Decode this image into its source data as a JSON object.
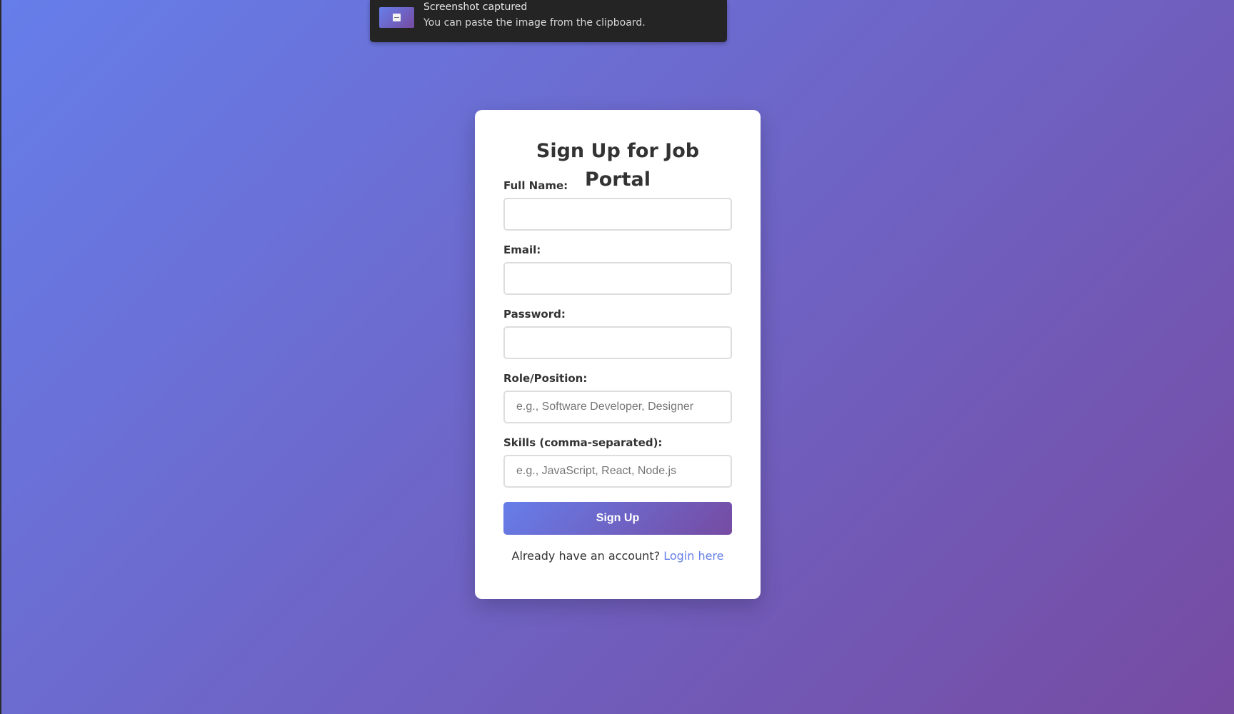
{
  "toast": {
    "title": "Screenshot captured",
    "body": "You can paste the image from the clipboard."
  },
  "form": {
    "title": "Sign Up for Job Portal",
    "fields": [
      {
        "label": "Full Name:",
        "value": "",
        "placeholder": ""
      },
      {
        "label": "Email:",
        "value": "",
        "placeholder": ""
      },
      {
        "label": "Password:",
        "value": "",
        "placeholder": ""
      },
      {
        "label": "Role/Position:",
        "value": "",
        "placeholder": "e.g., Software Developer, Designer"
      },
      {
        "label": "Skills (comma-separated):",
        "value": "",
        "placeholder": "e.g., JavaScript, React, Node.js"
      }
    ],
    "submit_label": "Sign Up",
    "login_prompt": "Already have an account?",
    "login_link": "Login here"
  },
  "colors": {
    "gradient_start": "#667eea",
    "gradient_end": "#764ba2",
    "link": "#667eea",
    "text": "#333333"
  },
  "icons": {
    "toast_thumbnail": "screenshot-thumbnail-icon"
  }
}
